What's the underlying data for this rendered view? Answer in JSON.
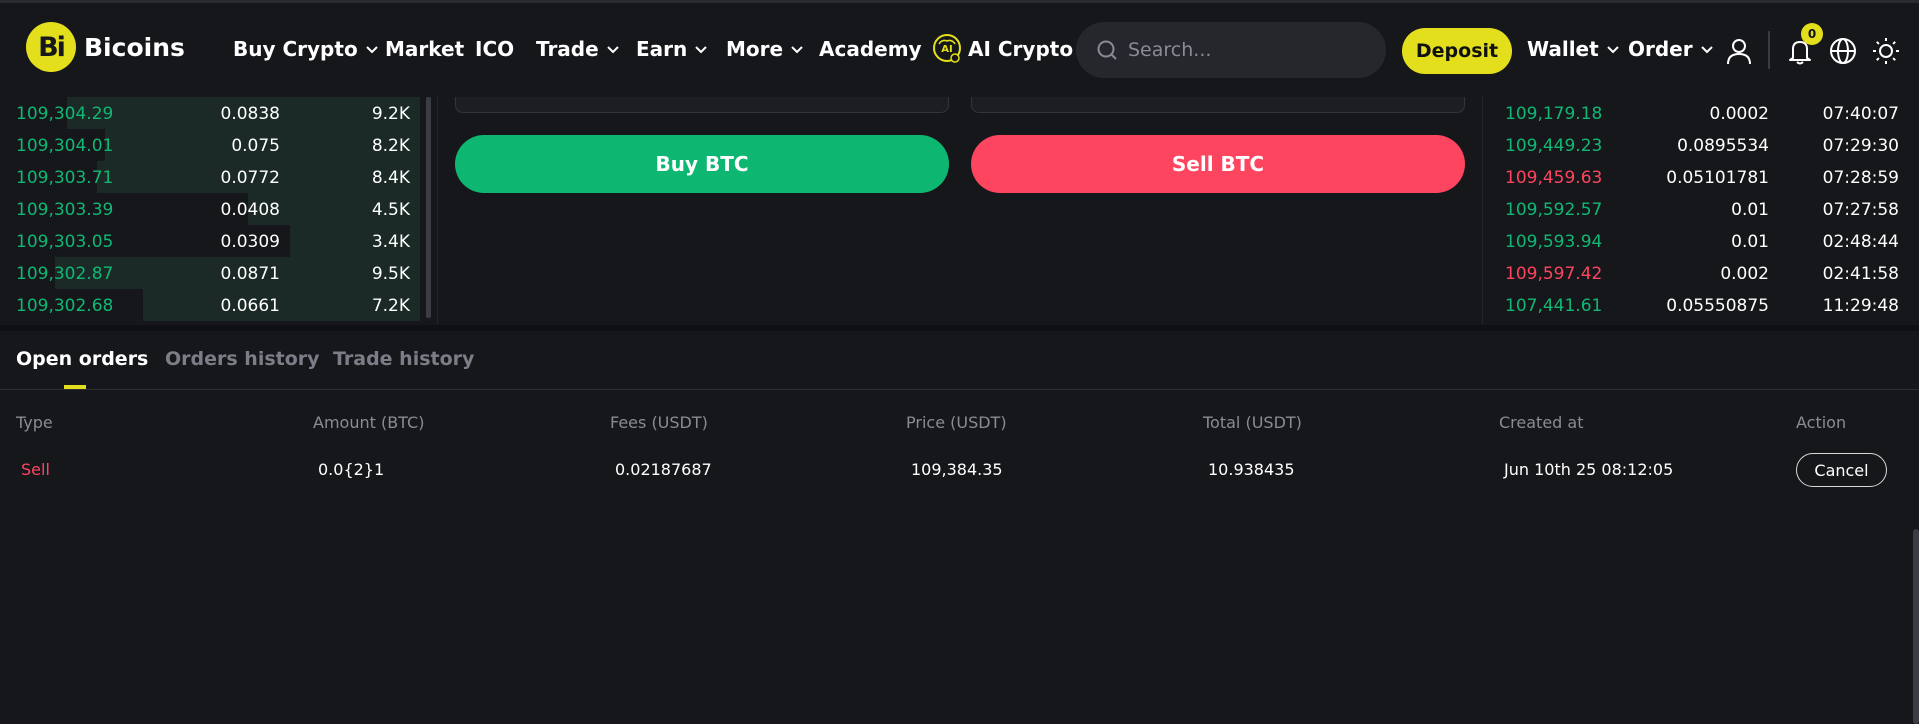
{
  "brand": {
    "mark": "Bi",
    "name": "Bicoins"
  },
  "nav": {
    "buy_crypto": "Buy Crypto",
    "market": "Market",
    "ico": "ICO",
    "trade": "Trade",
    "earn": "Earn",
    "more": "More",
    "academy": "Academy",
    "ai_crypto": "AI Crypto",
    "wallet": "Wallet",
    "order": "Order"
  },
  "search": {
    "placeholder": "Search..."
  },
  "deposit_label": "Deposit",
  "notifications": {
    "count": "0"
  },
  "colors": {
    "accent": "#e3df1c",
    "buy": "#0db772",
    "sell": "#fe4560",
    "bg": "#16171b"
  },
  "orderbook": {
    "rows": [
      {
        "price": "109,304.29",
        "amount": "0.0838",
        "total": "9.2K",
        "depth": 0.84
      },
      {
        "price": "109,304.01",
        "amount": "0.075",
        "total": "8.2K",
        "depth": 0.75
      },
      {
        "price": "109,303.71",
        "amount": "0.0772",
        "total": "8.4K",
        "depth": 0.77
      },
      {
        "price": "109,303.39",
        "amount": "0.0408",
        "total": "4.5K",
        "depth": 0.41
      },
      {
        "price": "109,303.05",
        "amount": "0.0309",
        "total": "3.4K",
        "depth": 0.31
      },
      {
        "price": "109,302.87",
        "amount": "0.0871",
        "total": "9.5K",
        "depth": 0.87
      },
      {
        "price": "109,302.68",
        "amount": "0.0661",
        "total": "7.2K",
        "depth": 0.66
      }
    ]
  },
  "tradeform": {
    "buy_label": "Buy BTC",
    "sell_label": "Sell BTC"
  },
  "trades": {
    "rows": [
      {
        "price": "109,179.18",
        "amount": "0.0002",
        "time": "07:40:07",
        "side": "buy"
      },
      {
        "price": "109,449.23",
        "amount": "0.0895534",
        "time": "07:29:30",
        "side": "buy"
      },
      {
        "price": "109,459.63",
        "amount": "0.05101781",
        "time": "07:28:59",
        "side": "sell"
      },
      {
        "price": "109,592.57",
        "amount": "0.01",
        "time": "07:27:58",
        "side": "buy"
      },
      {
        "price": "109,593.94",
        "amount": "0.01",
        "time": "02:48:44",
        "side": "buy"
      },
      {
        "price": "109,597.42",
        "amount": "0.002",
        "time": "02:41:58",
        "side": "sell"
      },
      {
        "price": "107,441.61",
        "amount": "0.05550875",
        "time": "11:29:48",
        "side": "buy"
      }
    ]
  },
  "orders": {
    "tabs": [
      "Open orders",
      "Orders history",
      "Trade history"
    ],
    "columns": [
      "Type",
      "Amount (BTC)",
      "Fees (USDT)",
      "Price (USDT)",
      "Total (USDT)",
      "Created at",
      "Action"
    ],
    "rows": [
      {
        "type": "Sell",
        "amount": "0.0{2}1",
        "fees": "0.02187687",
        "price": "109,384.35",
        "total": "10.938435",
        "created": "Jun 10th 25 08:12:05",
        "action": "Cancel"
      }
    ]
  }
}
